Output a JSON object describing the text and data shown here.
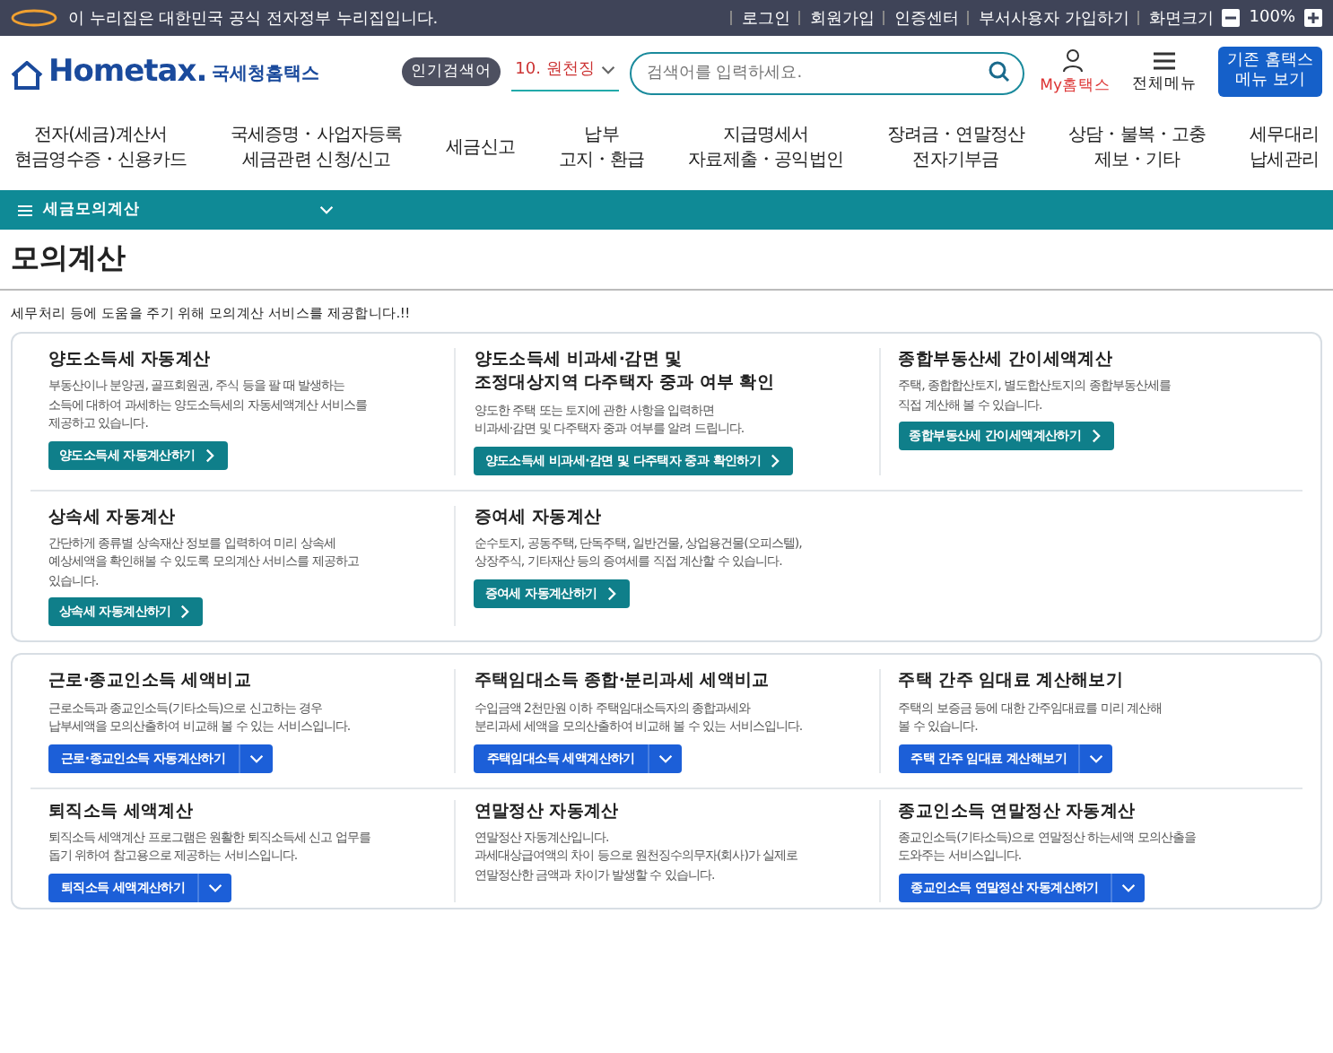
{
  "top_bar": {
    "notice": "이 누리집은 대한민국 공식 전자정부 누리집입니다.",
    "links": [
      "로그인",
      "회원가입",
      "인증센터",
      "부서사용자 가입하기",
      "화면크기"
    ],
    "zoom": "100%"
  },
  "header": {
    "logo": "Hometax.",
    "logo_sub": "국세청홈택스",
    "popular_badge": "인기검색어",
    "popular_item": "10. 원천징",
    "search": {
      "placeholder": "검색어를 입력하세요."
    },
    "my_label": "My홈택스",
    "menu_label": "전체메뉴",
    "legacy_button": "기존 홈택스 메뉴 보기"
  },
  "nav": [
    {
      "lines": [
        "전자(세금)계산서",
        "현금영수증・신용카드"
      ]
    },
    {
      "lines": [
        "국세증명・사업자등록",
        "세금관련 신청/신고"
      ]
    },
    {
      "lines": [
        "세금신고"
      ]
    },
    {
      "lines": [
        "납부",
        "고지・환급"
      ]
    },
    {
      "lines": [
        "지급명세서",
        "자료제출・공익법인"
      ]
    },
    {
      "lines": [
        "장려금・연말정산",
        "전자기부금"
      ]
    },
    {
      "lines": [
        "상담・불복・고충",
        "제보・기타"
      ]
    },
    {
      "lines": [
        "세무대리",
        "납세관리"
      ]
    }
  ],
  "breadcrumb": "세금모의계산",
  "page_title": "모의계산",
  "intro": "세무처리 등에 도움을 주기 위해 모의계산 서비스를 제공합니다.!!",
  "groups": [
    {
      "rows": [
        [
          {
            "title": "양도소득세 자동계산",
            "desc": [
              "부동산이나 분양권, 골프회원권, 주식 등을 팔 때 발생하는",
              "소득에 대하여 과세하는 양도소득세의 자동세액계산 서비스를",
              "제공하고 있습니다."
            ],
            "button": {
              "kind": "link",
              "label": "양도소득세 자동계산하기"
            }
          },
          {
            "title": "양도소득세 비과세·감면 및\n조정대상지역 다주택자 중과 여부 확인",
            "desc": [
              "양도한 주택 또는 토지에 관한 사항을 입력하면",
              "비과세·감면 및 다주택자 중과 여부를 알려 드립니다."
            ],
            "button": {
              "kind": "link",
              "label": "양도소득세 비과세·감면 및 다주택자 중과 확인하기"
            }
          },
          {
            "title": "종합부동산세 간이세액계산",
            "desc": [
              "주택, 종합합산토지, 별도합산토지의 종합부동산세를",
              "직접 계산해 볼 수 있습니다."
            ],
            "button": {
              "kind": "link",
              "label": "종합부동산세 간이세액계산하기"
            }
          }
        ],
        [
          {
            "title": "상속세 자동계산",
            "desc": [
              "간단하게 종류별 상속재산 정보를 입력하여 미리 상속세",
              "예상세액을 확인해볼 수 있도록 모의계산 서비스를 제공하고",
              "있습니다."
            ],
            "button": {
              "kind": "link",
              "label": "상속세 자동계산하기"
            }
          },
          {
            "title": "증여세 자동계산",
            "desc": [
              "순수토지, 공동주택, 단독주택, 일반건물, 상업용건물(오피스텔),",
              "상장주식, 기타재산 등의 증여세를 직접 계산할 수 있습니다."
            ],
            "button": {
              "kind": "link",
              "label": "증여세 자동계산하기"
            }
          }
        ]
      ]
    },
    {
      "rows": [
        [
          {
            "title": "근로·종교인소득 세액비교",
            "desc": [
              "근로소득과 종교인소득(기타소득)으로 신고하는 경우",
              "납부세액을 모의산출하여 비교해 볼 수 있는 서비스입니다."
            ],
            "button": {
              "kind": "dropdown",
              "label": "근로·종교인소득 자동계산하기"
            }
          },
          {
            "title": "주택임대소득 종합·분리과세 세액비교",
            "desc": [
              "수입금액 2천만원 이하 주택임대소득자의 종합과세와",
              "분리과세 세액을 모의산출하여 비교해 볼 수 있는 서비스입니다."
            ],
            "button": {
              "kind": "dropdown",
              "label": "주택임대소득 세액계산하기"
            }
          },
          {
            "title": "주택 간주 임대료 계산해보기",
            "desc": [
              "주택의 보증금 등에 대한 간주임대료를 미리 계산해",
              "볼 수 있습니다."
            ],
            "button": {
              "kind": "dropdown",
              "label": "주택 간주 임대료 계산해보기"
            }
          }
        ],
        [
          {
            "title": "퇴직소득 세액계산",
            "desc": [
              "퇴직소득 세액계산 프로그램은 원활한 퇴직소득세 신고 업무를",
              "돕기 위하여 참고용으로 제공하는 서비스입니다."
            ],
            "button": {
              "kind": "dropdown",
              "label": "퇴직소득 세액계산하기"
            }
          },
          {
            "title": "연말정산 자동계산",
            "desc": [
              "연말정산 자동계산입니다.",
              "과세대상급여액의 차이 등으로 원천징수의무자(회사)가 실제로",
              "연말정산한 금액과 차이가 발생할 수 있습니다."
            ]
          },
          {
            "title": "종교인소득 연말정산 자동계산",
            "desc": [
              "종교인소득(기타소득)으로 연말정산 하는세액 모의산출을",
              "도와주는 서비스입니다."
            ],
            "button": {
              "kind": "dropdown",
              "label": "종교인소득 연말정산 자동계산하기"
            }
          }
        ]
      ]
    }
  ]
}
